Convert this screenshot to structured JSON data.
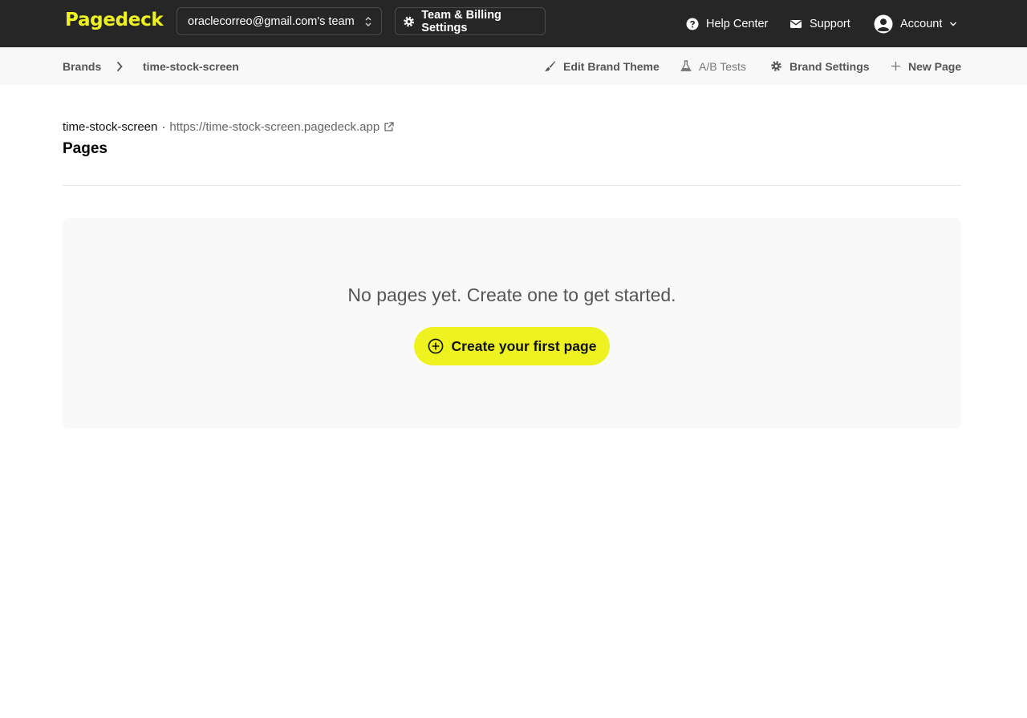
{
  "app": {
    "logo": "Pagedeck"
  },
  "header": {
    "team_selector": "oraclecorreo@gmail.com's team",
    "billing_label": "Team & Billing Settings",
    "help_label": "Help Center",
    "support_label": "Support",
    "account_label": "Account"
  },
  "breadcrumb": {
    "brands": "Brands",
    "current": "time-stock-screen"
  },
  "actions": {
    "edit_theme": "Edit Brand Theme",
    "ab_tests": "A/B Tests",
    "brand_settings": "Brand Settings",
    "new_page": "New Page"
  },
  "main": {
    "site_name": "time-stock-screen",
    "separator": "·",
    "site_url": "https://time-stock-screen.pagedeck.app",
    "title": "Pages",
    "empty_message": "No pages yet. Create one to get started.",
    "create_button": "Create your first page"
  },
  "colors": {
    "brand_accent": "#eef221",
    "topbar_bg": "#262626",
    "subbar_bg": "#f8f8f8",
    "panel_bg": "#f9f9f9"
  },
  "icons": {
    "team_chevron": "chevron-up-down-icon",
    "billing": "gear-icon",
    "help": "question-circle-icon",
    "support": "envelope-icon",
    "account": "user-circle-icon",
    "account_caret": "chevron-down-icon",
    "crumb_sep": "chevron-right-icon",
    "edit_theme": "paintbrush-icon",
    "ab_tests": "flask-icon",
    "brand_settings": "gear-icon",
    "new_page": "plus-icon",
    "external": "external-link-icon",
    "create": "plus-circle-icon"
  }
}
